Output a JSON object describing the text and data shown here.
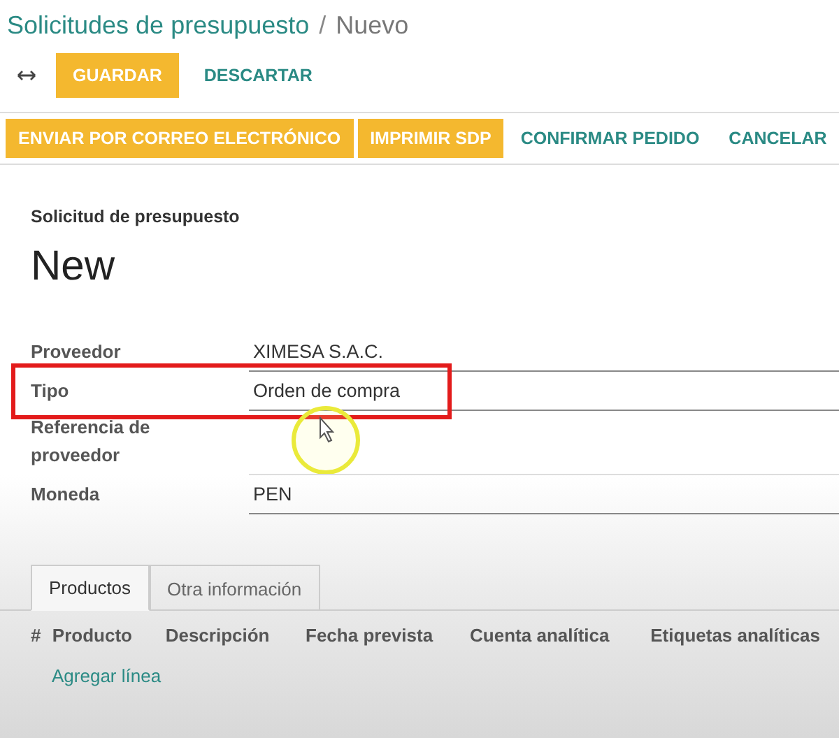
{
  "breadcrumb": {
    "parent": "Solicitudes de presupuesto",
    "separator": "/",
    "current": "Nuevo"
  },
  "toolbar": {
    "buttons": [
      {
        "label": "GUARDAR",
        "kind": "primary"
      },
      {
        "label": "DESCARTAR",
        "kind": "link"
      }
    ]
  },
  "status_bar": {
    "buttons": [
      {
        "label": "ENVIAR POR CORREO ELECTRÓNICO",
        "kind": "primary"
      },
      {
        "label": "IMPRIMIR SDP",
        "kind": "primary"
      },
      {
        "label": "CONFIRMAR PEDIDO",
        "kind": "link"
      },
      {
        "label": "CANCELAR",
        "kind": "link"
      }
    ]
  },
  "form": {
    "subtitle": "Solicitud de presupuesto",
    "title": "New",
    "fields": [
      {
        "label": "Proveedor",
        "value": "XIMESA S.A.C.",
        "highlighted": false
      },
      {
        "label": "Tipo",
        "value": "Orden de compra",
        "highlighted": true
      },
      {
        "label": "Referencia de proveedor",
        "highlighted": false
      },
      {
        "label": "Moneda",
        "value": "PEN",
        "highlighted": false
      }
    ]
  },
  "tabs": [
    {
      "label": "Productos",
      "selected": true
    },
    {
      "label": "Otra información",
      "selected": false
    }
  ],
  "table": {
    "columns": [
      "#",
      "Producto",
      "Descripción",
      "Fecha prevista",
      "Cuenta analítica",
      "Etiquetas analíticas"
    ],
    "add_line": "Agregar línea"
  }
}
